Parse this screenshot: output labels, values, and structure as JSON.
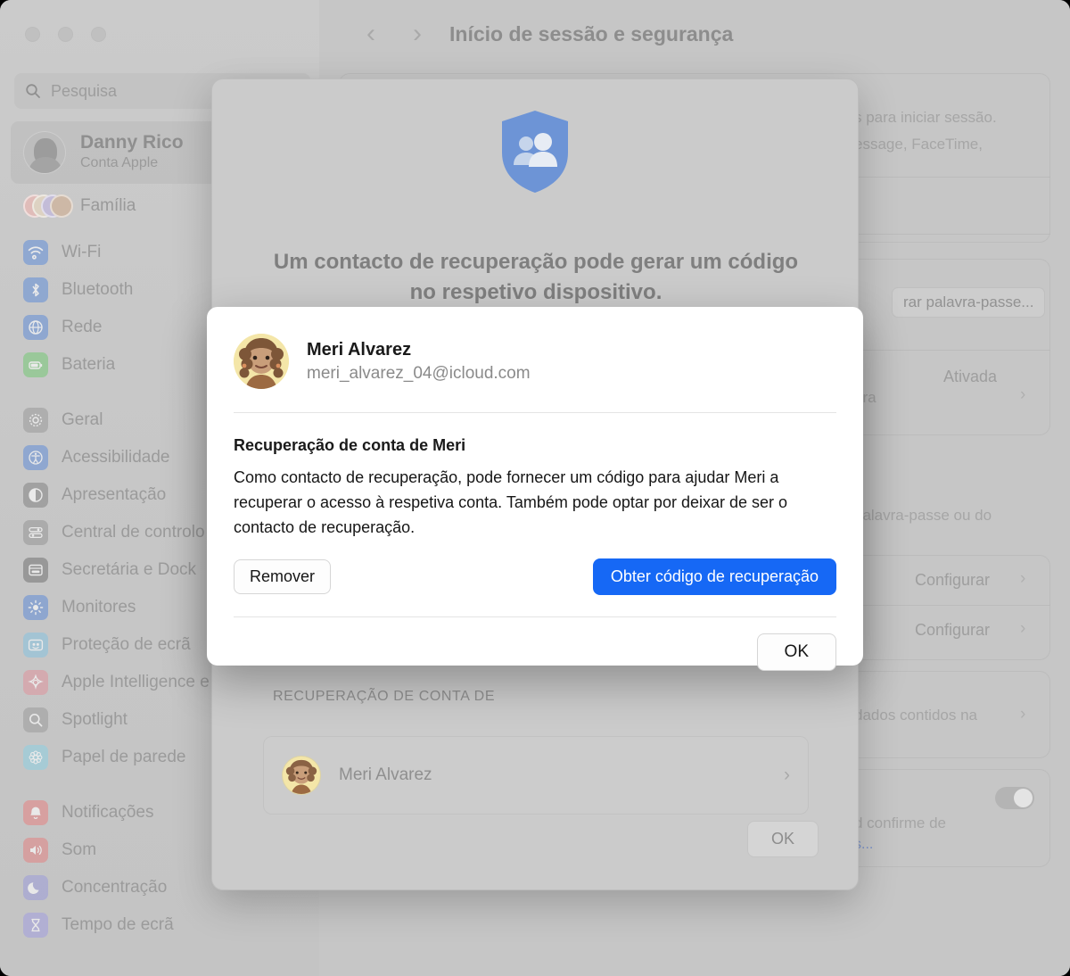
{
  "window": {
    "traffic_lights": [
      "close",
      "minimize",
      "zoom"
    ],
    "page_title": "Início de sessão e segurança",
    "back_arrow": "‹",
    "forward_arrow": "›"
  },
  "sidebar": {
    "search": {
      "placeholder": "Pesquisa",
      "icon": "search-icon"
    },
    "account": {
      "name": "Danny Rico",
      "subtitle": "Conta Apple"
    },
    "family": {
      "label": "Família"
    },
    "groups": [
      {
        "items": [
          {
            "label": "Wi-Fi",
            "icon": "wifi-icon",
            "color": "#6d94d6"
          },
          {
            "label": "Bluetooth",
            "icon": "bluetooth-icon",
            "color": "#6d94d6"
          },
          {
            "label": "Rede",
            "icon": "globe-icon",
            "color": "#6d94d6"
          },
          {
            "label": "Bateria",
            "icon": "battery-icon",
            "color": "#7fc97f"
          }
        ]
      },
      {
        "items": [
          {
            "label": "Geral",
            "icon": "gear-icon",
            "color": "#a0a0a0"
          },
          {
            "label": "Acessibilidade",
            "icon": "accessibility-icon",
            "color": "#6d94d6"
          },
          {
            "label": "Apresentação",
            "icon": "appearance-icon",
            "color": "#8a8a8a"
          },
          {
            "label": "Central de controlo",
            "icon": "control-center-icon",
            "color": "#9b9b9b"
          },
          {
            "label": "Secretária e Dock",
            "icon": "desktop-dock-icon",
            "color": "#7d7d7d"
          },
          {
            "label": "Monitores",
            "icon": "displays-icon",
            "color": "#6d94d6"
          },
          {
            "label": "Proteção de ecrã",
            "icon": "screensaver-icon",
            "color": "#8fc3dd"
          },
          {
            "label": "Apple Intelligence e",
            "icon": "apple-intelligence-icon",
            "color": "#dd9aa2"
          },
          {
            "label": "Spotlight",
            "icon": "spotlight-icon",
            "color": "#a0a0a0"
          },
          {
            "label": "Papel de parede",
            "icon": "wallpaper-icon",
            "color": "#94cfe0"
          }
        ]
      },
      {
        "items": [
          {
            "label": "Notificações",
            "icon": "bell-icon",
            "color": "#e38b8b"
          },
          {
            "label": "Som",
            "icon": "speaker-icon",
            "color": "#e08a8a"
          },
          {
            "label": "Concentração",
            "icon": "moon-icon",
            "color": "#a0a0d8"
          },
          {
            "label": "Tempo de ecrã",
            "icon": "hourglass-icon",
            "color": "#a7a3dd"
          }
        ]
      }
    ]
  },
  "background_pane": {
    "snippets": [
      {
        "text": "s para iniciar sessão."
      },
      {
        "text": "essage, FaceTime,"
      },
      {
        "text": "palavra-passe ou do"
      },
      {
        "text": "dados contidos na"
      },
      {
        "text": "d confirme de"
      },
      {
        "text": "ara"
      }
    ],
    "pill_label": "rar palavra-passe...",
    "values": [
      "Ativada",
      "Configurar",
      "Configurar"
    ],
    "link_text": "s...",
    "chevron": "›",
    "toggle_state": "on"
  },
  "outer_sheet": {
    "shield_icon": "shield-people-icon",
    "heading": "Um contacto de recuperação pode gerar um código no respetivo dispositivo.",
    "section_label": "RECUPERAÇÃO DE CONTA DE",
    "contact_row": {
      "name": "Meri Alvarez",
      "chevron": "›",
      "avatar": "meri-avatar"
    },
    "ok_label": "OK"
  },
  "inner_sheet": {
    "person": {
      "name": "Meri Alvarez",
      "email": "meri_alvarez_04@icloud.com",
      "avatar": "meri-avatar"
    },
    "body_title": "Recuperação de conta de Meri",
    "body_text": "Como contacto de recuperação, pode fornecer um código para ajudar Meri a recuperar o acesso à respetiva conta. Também pode optar por deixar de ser o contacto de recuperação.",
    "remove_label": "Remover",
    "primary_label": "Obter código de recuperação",
    "ok_label": "OK"
  },
  "colors": {
    "accent_blue": "#1668f5",
    "shield_blue": "#6d94d6",
    "window_grey": "#c8c8c8",
    "sheet_grey": "#cbcbcb",
    "dialog_white": "#ffffff"
  }
}
